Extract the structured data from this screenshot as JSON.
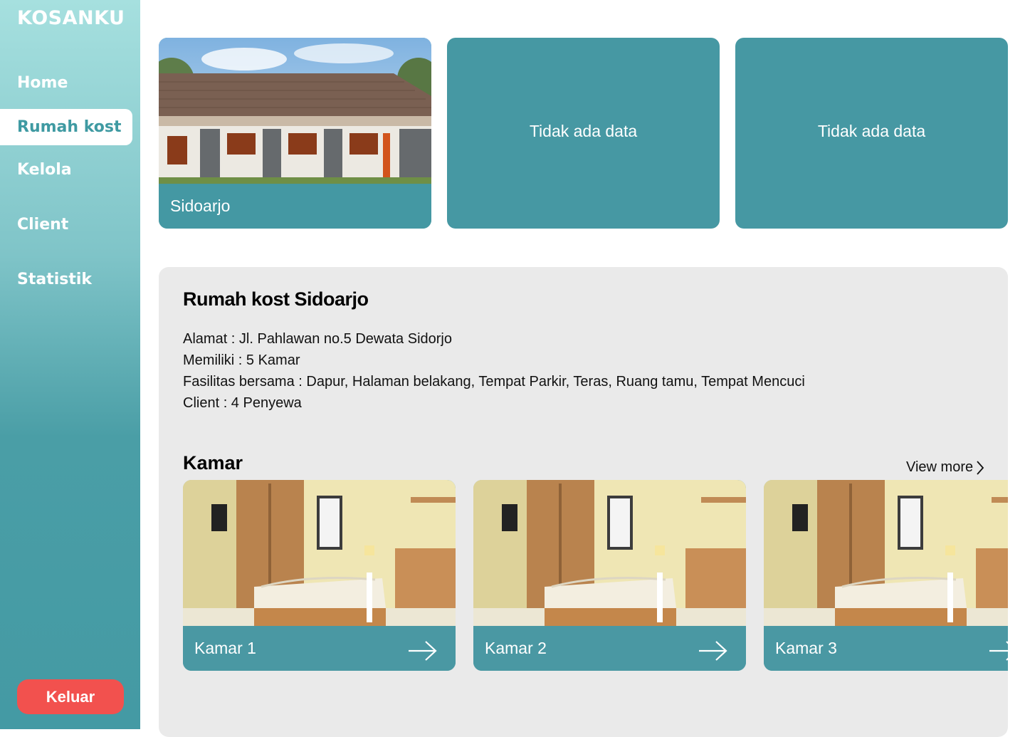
{
  "sidebar": {
    "brand": "KOSANKU",
    "items": [
      {
        "label": "Home",
        "active": false
      },
      {
        "label": "Rumah kost",
        "active": true
      },
      {
        "label": "Kelola",
        "active": false
      },
      {
        "label": "Client",
        "active": false
      },
      {
        "label": "Statistik",
        "active": false
      }
    ],
    "logout_label": "Keluar"
  },
  "properties": [
    {
      "caption": "Sidoarjo",
      "image": "house-photo"
    },
    {
      "empty_label": "Tidak ada data"
    },
    {
      "empty_label": "Tidak ada data"
    }
  ],
  "detail": {
    "title": "Rumah kost Sidoarjo",
    "alamat": "Alamat : Jl. Pahlawan no.5  Dewata Sidorjo",
    "memiliki": "Memiliki : 5 Kamar",
    "fasilitas": "Fasilitas bersama : Dapur, Halaman belakang, Tempat Parkir, Teras, Ruang tamu, Tempat Mencuci",
    "client": "Client : 4 Penyewa"
  },
  "kamar": {
    "title": "Kamar",
    "view_more": "View  more",
    "rooms": [
      {
        "label": "Kamar 1"
      },
      {
        "label": "Kamar 2"
      },
      {
        "label": "Kamar 3"
      }
    ]
  },
  "colors": {
    "accent": "#4698a3",
    "danger": "#f2514e",
    "panel": "#eaeaea"
  }
}
